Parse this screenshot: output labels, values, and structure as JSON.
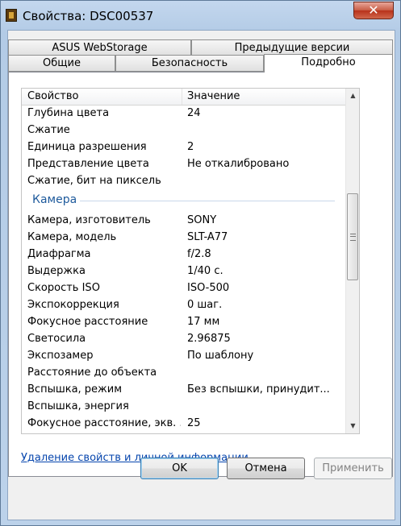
{
  "window": {
    "title": "Свойства: DSC00537",
    "close_label": "✕"
  },
  "tabs": {
    "row1": [
      "ASUS WebStorage",
      "Предыдущие версии"
    ],
    "row2": [
      "Общие",
      "Безопасность",
      "Подробно"
    ]
  },
  "list": {
    "header": {
      "property": "Свойство",
      "value": "Значение"
    },
    "rows_top": [
      {
        "name": "Глубина цвета",
        "value": "24"
      },
      {
        "name": "Сжатие",
        "value": ""
      },
      {
        "name": "Единица разрешения",
        "value": "2"
      },
      {
        "name": "Представление цвета",
        "value": "Не откалибровано"
      },
      {
        "name": "Сжатие, бит на пиксель",
        "value": ""
      }
    ],
    "group": "Камера",
    "rows_camera": [
      {
        "name": "Камера, изготовитель",
        "value": "SONY"
      },
      {
        "name": "Камера, модель",
        "value": "SLT-A77"
      },
      {
        "name": "Диафрагма",
        "value": "f/2.8"
      },
      {
        "name": "Выдержка",
        "value": "1/40 с."
      },
      {
        "name": "Скорость ISO",
        "value": "ISO-500"
      },
      {
        "name": "Экспокоррекция",
        "value": "0 шаг."
      },
      {
        "name": "Фокусное расстояние",
        "value": "17 мм"
      },
      {
        "name": "Светосила",
        "value": "2.96875"
      },
      {
        "name": "Экспозамер",
        "value": "По шаблону"
      },
      {
        "name": "Расстояние до объекта",
        "value": ""
      },
      {
        "name": "Вспышка, режим",
        "value": "Без вспышки, принудит..."
      },
      {
        "name": "Вспышка, энергия",
        "value": ""
      },
      {
        "name": "Фокусное расстояние, экв. ...",
        "value": "25"
      }
    ]
  },
  "link_text": "Удаление свойств и личной информации",
  "buttons": {
    "ok": "OK",
    "cancel": "Отмена",
    "apply": "Применить"
  }
}
